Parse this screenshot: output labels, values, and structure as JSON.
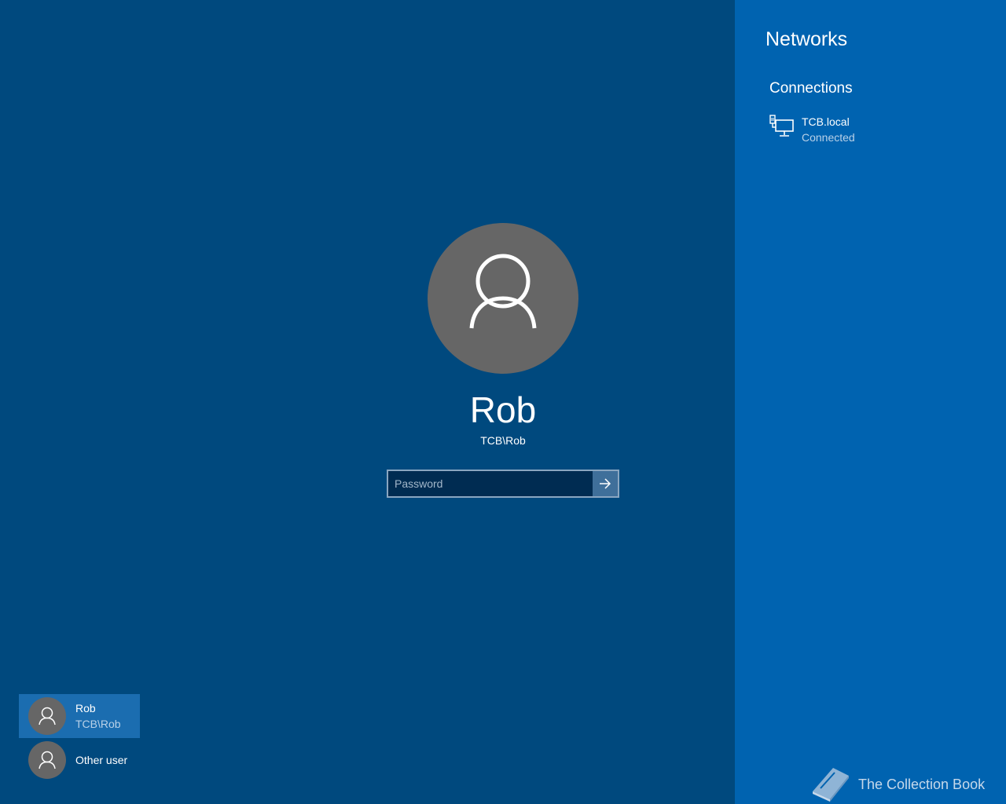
{
  "user": {
    "display_name": "Rob",
    "account": "TCB\\Rob"
  },
  "password": {
    "placeholder": "Password",
    "value": "",
    "submit_icon": "arrow-right-icon"
  },
  "user_list": [
    {
      "name": "Rob",
      "account": "TCB\\Rob",
      "selected": true
    },
    {
      "name": "Other user",
      "selected": false
    }
  ],
  "networks": {
    "title": "Networks",
    "connections_heading": "Connections",
    "items": [
      {
        "name": "TCB.local",
        "status": "Connected",
        "icon": "wired-network-icon"
      }
    ]
  },
  "watermark": {
    "text": "The Collection Book",
    "icon": "book-icon"
  },
  "colors": {
    "background": "#00497e",
    "panel": "#0063b0",
    "avatar": "#666666",
    "selected_tile": "#1b6db0",
    "text": "#ffffff"
  }
}
